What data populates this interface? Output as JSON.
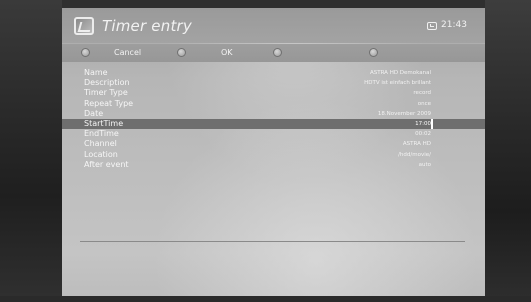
{
  "window": {
    "title": "Timer entry",
    "clock": "21:43"
  },
  "buttons": [
    {
      "label": "Cancel",
      "color": "red"
    },
    {
      "label": "OK",
      "color": "green"
    },
    {
      "label": "",
      "color": "yellow"
    },
    {
      "label": "",
      "color": "blue"
    }
  ],
  "fields": [
    {
      "label": "Name",
      "value": "ASTRA HD Demokanal"
    },
    {
      "label": "Description",
      "value": "HDTV ist einfach brillant"
    },
    {
      "label": "Timer Type",
      "value": "record"
    },
    {
      "label": "Repeat Type",
      "value": "once"
    },
    {
      "label": "Date",
      "value": "18.November 2009"
    },
    {
      "label": "StartTime",
      "value": "17:00",
      "selected": true
    },
    {
      "label": "EndTime",
      "value": "00:02"
    },
    {
      "label": "Channel",
      "value": "ASTRA HD"
    },
    {
      "label": "Location",
      "value": "/hdd/movie/"
    },
    {
      "label": "After event",
      "value": "auto"
    }
  ],
  "icons": {
    "app": "timer-app-icon",
    "clock": "clock-icon"
  }
}
